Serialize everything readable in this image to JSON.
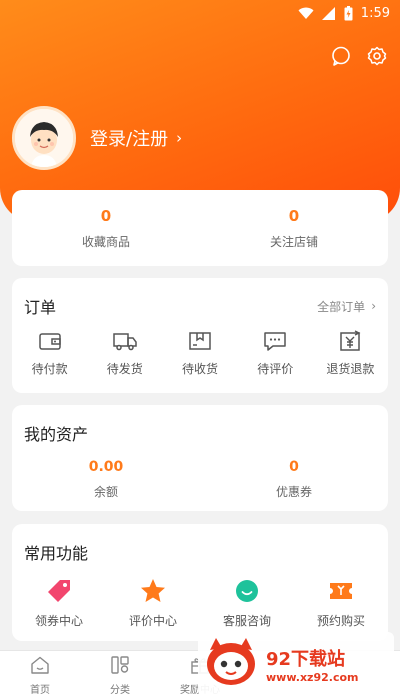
{
  "status": {
    "time": "1:59"
  },
  "profile": {
    "login_label": "登录/注册",
    "chevron": "›"
  },
  "stats": {
    "favorites_count": "0",
    "favorites_label": "收藏商品",
    "follow_count": "0",
    "follow_label": "关注店铺"
  },
  "orders": {
    "title": "订单",
    "all_label": "全部订单",
    "chevron": "›",
    "items": [
      {
        "label": "待付款",
        "icon": "wallet-icon"
      },
      {
        "label": "待发货",
        "icon": "truck-icon"
      },
      {
        "label": "待收货",
        "icon": "package-icon"
      },
      {
        "label": "待评价",
        "icon": "comment-icon"
      },
      {
        "label": "退货退款",
        "icon": "refund-icon"
      }
    ]
  },
  "assets": {
    "title": "我的资产",
    "balance_value": "0.00",
    "balance_label": "余额",
    "coupon_value": "0",
    "coupon_label": "优惠券"
  },
  "features": {
    "title": "常用功能",
    "items": [
      {
        "label": "领券中心",
        "icon": "tag-icon",
        "color": "#f2466e"
      },
      {
        "label": "评价中心",
        "icon": "star-icon",
        "color": "#ff7a1a"
      },
      {
        "label": "客服咨询",
        "icon": "smile-icon",
        "color": "#1ec29b"
      },
      {
        "label": "预约购买",
        "icon": "ticket-icon",
        "color": "#ff7a1a"
      }
    ]
  },
  "tabbar": [
    {
      "label": "首页",
      "icon": "home-icon"
    },
    {
      "label": "分类",
      "icon": "category-icon"
    },
    {
      "label": "奖励中心",
      "icon": "gift-icon"
    }
  ],
  "watermark": {
    "title": "92下载站",
    "url": "www.xz92.com"
  },
  "colors": {
    "accent": "#ff7a1a",
    "hero_start": "#ff8c1a",
    "hero_end": "#ff4d0a"
  }
}
